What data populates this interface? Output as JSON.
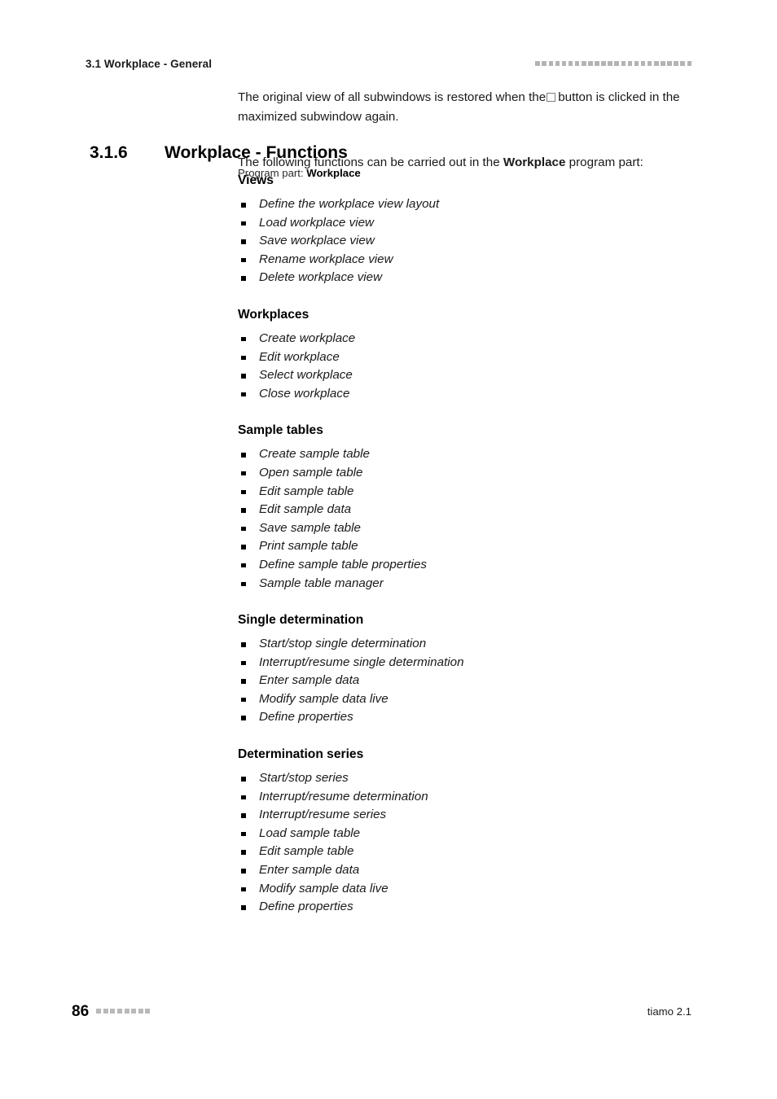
{
  "header": {
    "running_title": "3.1 Workplace - General",
    "decor_squares": 24
  },
  "intro_paragraph": {
    "before_glyph": "The original view of all subwindows is restored when the",
    "glyph": "restore-button-icon",
    "after_glyph": "button is clicked in the maximized subwindow again."
  },
  "section": {
    "number": "3.1.6",
    "title": "Workplace - Functions",
    "program_part_label": "Program part:",
    "program_part_value": "Workplace",
    "lead_in_before": "The following functions can be carried out in the",
    "lead_in_bold": "Workplace",
    "lead_in_after": "program part:"
  },
  "groups": [
    {
      "title": "Views",
      "items": [
        "Define the workplace view layout",
        "Load workplace view",
        "Save workplace view",
        "Rename workplace view",
        "Delete workplace view"
      ]
    },
    {
      "title": "Workplaces",
      "items": [
        "Create workplace",
        "Edit workplace",
        "Select workplace",
        "Close workplace"
      ]
    },
    {
      "title": "Sample tables",
      "items": [
        "Create sample table",
        "Open sample table",
        "Edit sample table",
        "Edit sample data",
        "Save sample table",
        "Print sample table",
        "Define sample table properties",
        "Sample table manager"
      ]
    },
    {
      "title": "Single determination",
      "items": [
        "Start/stop single determination",
        "Interrupt/resume single determination",
        "Enter sample data",
        "Modify sample data live",
        "Define properties"
      ]
    },
    {
      "title": "Determination series",
      "items": [
        "Start/stop series",
        "Interrupt/resume determination",
        "Interrupt/resume series",
        "Load sample table",
        "Edit sample table",
        "Enter sample data",
        "Modify sample data live",
        "Define properties"
      ]
    }
  ],
  "footer": {
    "page_number": "86",
    "decor_squares": 8,
    "product": "tiamo 2.1"
  },
  "colors": {
    "text": "#1a1a1a",
    "heading": "#000000",
    "decor_gray": "#b4b4b4"
  }
}
